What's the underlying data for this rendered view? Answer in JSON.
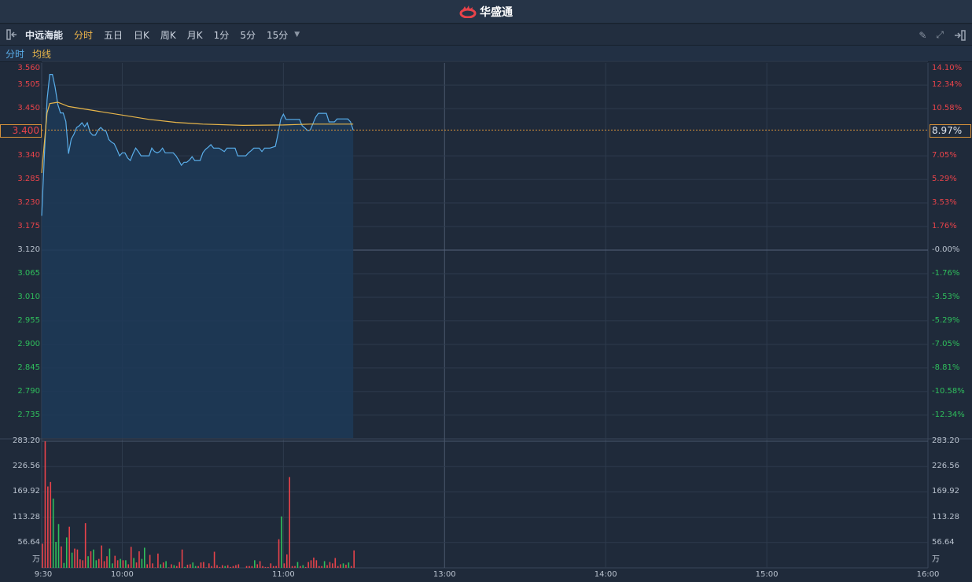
{
  "app": {
    "logo_text": "华盛通"
  },
  "toolbar": {
    "stock_name": "中远海能",
    "periods": [
      "分时",
      "五日",
      "日K",
      "周K",
      "月K",
      "1分",
      "5分",
      "15分"
    ],
    "active": "分时"
  },
  "legend": {
    "price_label": "分时",
    "avg_label": "均线"
  },
  "colors": {
    "up": "#e8434a",
    "down": "#2fbf5c",
    "price_line": "#5aaeea",
    "avg_line": "#e8b64a",
    "accent": "#f0b64a"
  },
  "price_axis": {
    "prev_close": 3.12,
    "max": 3.56,
    "labels": [
      "3.560",
      "3.505",
      "3.450",
      "3.340",
      "3.285",
      "3.230",
      "3.175",
      "3.120",
      "3.065",
      "3.010",
      "2.955",
      "2.900",
      "2.845",
      "2.790",
      "2.735"
    ],
    "pct_labels": [
      "14.10%",
      "12.34%",
      "10.58%",
      "7.05%",
      "5.29%",
      "3.53%",
      "1.76%",
      "-0.00%",
      "-1.76%",
      "-3.53%",
      "-5.29%",
      "-7.05%",
      "-8.81%",
      "-10.58%",
      "-12.34%"
    ]
  },
  "current": {
    "price": "3.400",
    "pct": "8.97%",
    "value": 3.4
  },
  "volume_axis": {
    "max": 283.2,
    "labels": [
      "283.20",
      "226.56",
      "169.92",
      "113.28",
      "56.64"
    ],
    "unit": "万"
  },
  "time_axis": {
    "labels": [
      "9:30",
      "10:00",
      "11:00",
      "13:00",
      "14:00",
      "15:00",
      "16:00"
    ],
    "minutes": [
      0,
      30,
      90,
      150,
      210,
      270,
      330
    ],
    "total_minutes": 330
  },
  "chart_data": {
    "type": "line",
    "prices": [
      3.2,
      3.34,
      3.47,
      3.53,
      3.53,
      3.5,
      3.46,
      3.44,
      3.44,
      3.42,
      3.345,
      3.379,
      3.39,
      3.406,
      3.41,
      3.417,
      3.408,
      3.417,
      3.395,
      3.388,
      3.388,
      3.4,
      3.406,
      3.4,
      3.397,
      3.378,
      3.372,
      3.368,
      3.355,
      3.34,
      3.347,
      3.347,
      3.335,
      3.329,
      3.345,
      3.358,
      3.35,
      3.34,
      3.34,
      3.34,
      3.34,
      3.358,
      3.35,
      3.347,
      3.35,
      3.358,
      3.347,
      3.347,
      3.347,
      3.347,
      3.34,
      3.33,
      3.318,
      3.325,
      3.325,
      3.33,
      3.338,
      3.329,
      3.329,
      3.329,
      3.347,
      3.355,
      3.36,
      3.366,
      3.358,
      3.358,
      3.358,
      3.354,
      3.35,
      3.358,
      3.358,
      3.358,
      3.358,
      3.34,
      3.34,
      3.34,
      3.34,
      3.347,
      3.352,
      3.358,
      3.358,
      3.358,
      3.35,
      3.358,
      3.358,
      3.358,
      3.36,
      3.362,
      3.391,
      3.425,
      3.437,
      3.425,
      3.425,
      3.425,
      3.425,
      3.425,
      3.425,
      3.41,
      3.405,
      3.399,
      3.4,
      3.415,
      3.43,
      3.439,
      3.439,
      3.439,
      3.439,
      3.419,
      3.419,
      3.419,
      3.426,
      3.426,
      3.426,
      3.426,
      3.426,
      3.419,
      3.4
    ],
    "avg": [
      [
        0,
        3.3
      ],
      [
        2,
        3.44
      ],
      [
        3,
        3.462
      ],
      [
        6,
        3.465
      ],
      [
        10,
        3.455
      ],
      [
        20,
        3.445
      ],
      [
        30,
        3.435
      ],
      [
        40,
        3.425
      ],
      [
        50,
        3.418
      ],
      [
        60,
        3.414
      ],
      [
        75,
        3.411
      ],
      [
        90,
        3.412
      ],
      [
        100,
        3.414
      ],
      [
        116,
        3.414
      ]
    ],
    "volumes": [
      54,
      283,
      182,
      192,
      155,
      58,
      98,
      48,
      11,
      68,
      92,
      34,
      43,
      41,
      19,
      17,
      100,
      26,
      37,
      41,
      17,
      20,
      50,
      15,
      26,
      43,
      10,
      27,
      17,
      20,
      17,
      17,
      8,
      47,
      22,
      12,
      37,
      20,
      45,
      8,
      29,
      10,
      1,
      32,
      8,
      12,
      15,
      1,
      8,
      6,
      4,
      13,
      41,
      2,
      7,
      8,
      12,
      4,
      4,
      12,
      13,
      1,
      10,
      4,
      36,
      6,
      2,
      6,
      4,
      6,
      2,
      4,
      6,
      8,
      0,
      0,
      4,
      4,
      4,
      17,
      8,
      15,
      4,
      2,
      2,
      10,
      4,
      4,
      64,
      115,
      10,
      30,
      203,
      4,
      4,
      13,
      4,
      6,
      2,
      13,
      17,
      23,
      17,
      4,
      4,
      15,
      6,
      13,
      10,
      22,
      4,
      8,
      10,
      7,
      12,
      4,
      39
    ],
    "volume_dir": "rrrrgggrggrgrrrrrgrggrrrrggrrgrgrrgrrggrrrrrgrgrrgrrrgrrggrrrrrrrrrrgrrrrrgrrrrgrrrrrrrrrgrrrrrgrgrrrrrrrgrrrrrrgrg"
  }
}
